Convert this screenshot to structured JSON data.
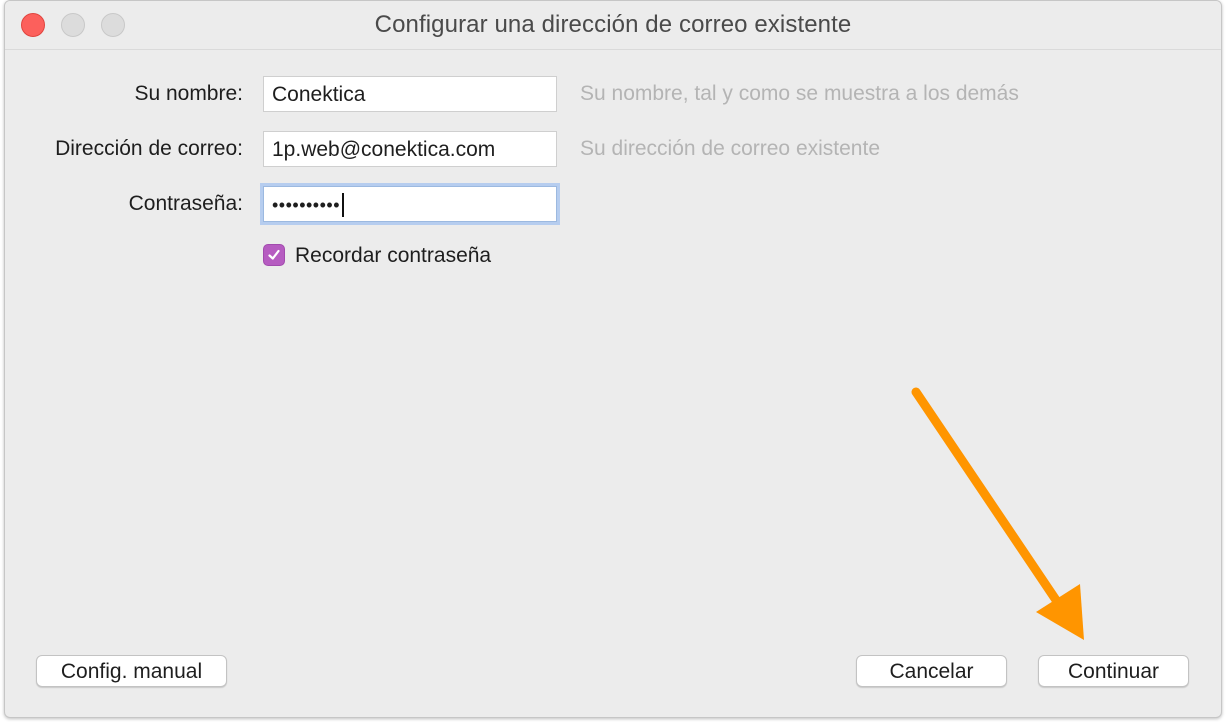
{
  "window": {
    "title": "Configurar una dirección de correo existente"
  },
  "form": {
    "name": {
      "label": "Su nombre:",
      "value": "Conektica",
      "hint": "Su nombre, tal y como se muestra a los demás"
    },
    "email": {
      "label": "Dirección de correo:",
      "value": "1p.web@conektica.com",
      "hint": "Su dirección de correo existente"
    },
    "password": {
      "label": "Contraseña:",
      "masked_value": "••••••••••"
    },
    "remember": {
      "label": "Recordar contraseña",
      "checked": true
    }
  },
  "buttons": {
    "manual": "Config. manual",
    "cancel": "Cancelar",
    "continue": "Continuar"
  },
  "colors": {
    "accent_checkbox": "#b65cc1",
    "annotation_arrow": "#ff9500",
    "close_button": "#fc605c"
  }
}
